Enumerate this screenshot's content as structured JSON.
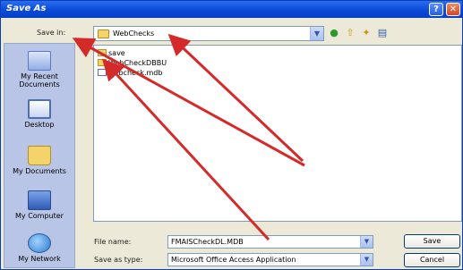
{
  "window": {
    "title": "Save As"
  },
  "titlebar": {
    "help_glyph": "?",
    "close_glyph": "✕"
  },
  "toolbar": {
    "save_in_label": "Save in:",
    "save_in_value": "WebChecks",
    "icons": [
      "back-icon",
      "up-folder-icon",
      "new-folder-icon",
      "views-menu-icon"
    ]
  },
  "places": [
    {
      "label": "My Recent Documents",
      "icon": "recent-documents-icon"
    },
    {
      "label": "Desktop",
      "icon": "desktop-icon"
    },
    {
      "label": "My Documents",
      "icon": "my-documents-icon"
    },
    {
      "label": "My Computer",
      "icon": "my-computer-icon"
    },
    {
      "label": "My Network",
      "icon": "my-network-icon"
    }
  ],
  "files": [
    {
      "name": "save",
      "type": "folder"
    },
    {
      "name": "WebCheckDBBU",
      "type": "folder"
    },
    {
      "name": "webcheck.mdb",
      "type": "file"
    }
  ],
  "bottom": {
    "file_name_label": "File name:",
    "file_name_value": "FMAISCheckDL.MDB",
    "save_as_type_label": "Save as type:",
    "save_as_type_value": "Microsoft Office Access Application",
    "save_button": "Save",
    "cancel_button": "Cancel"
  },
  "colors": {
    "titlebar": "#0a4ad6",
    "places_bar": "#b9c5e6",
    "dialog_bg": "#ece9d8",
    "arrow": "#d42a2a"
  },
  "annotations": {
    "arrow_count": 3
  }
}
